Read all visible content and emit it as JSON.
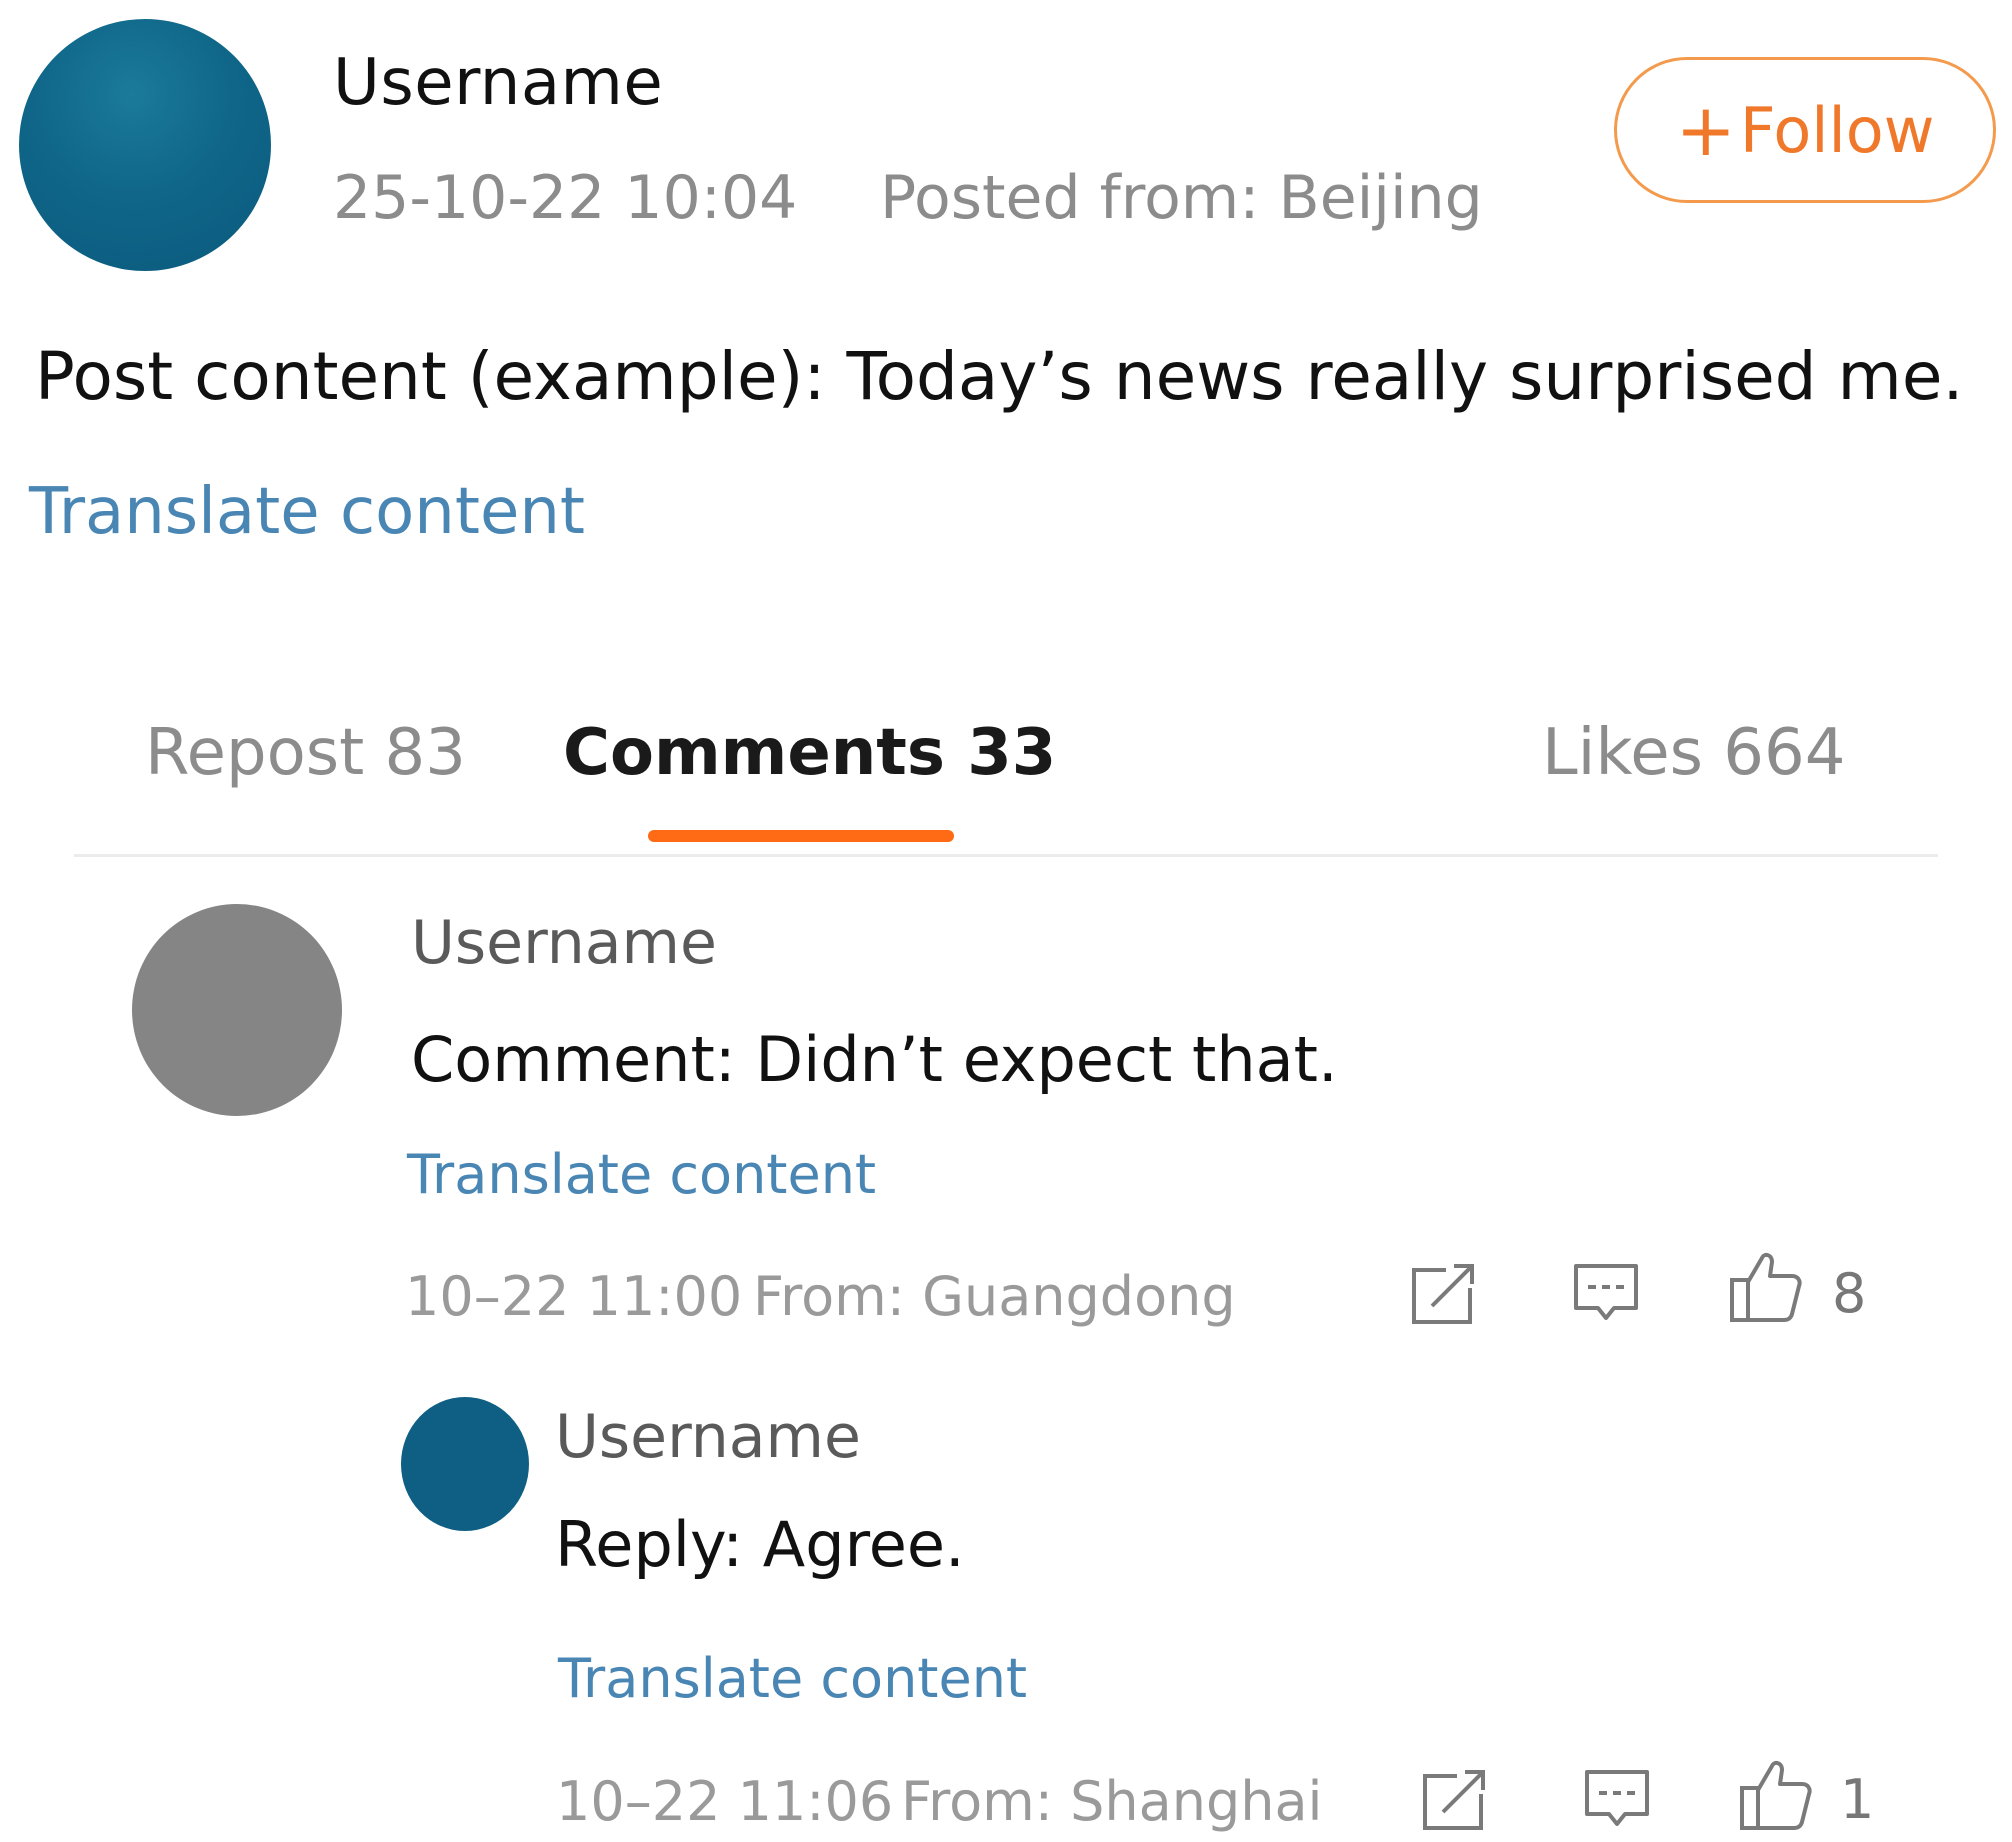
{
  "post": {
    "username": "Username",
    "timestamp": "25-10-22 10:04",
    "location": "Posted from: Beijing",
    "content": "Post content (example): Today’s news really surprised me.",
    "translate_label": "Translate content",
    "follow_label": "Follow",
    "follow_plus": "+",
    "avatar_color": "#0f6688"
  },
  "tabs": {
    "repost": "Repost 83",
    "comments": "Comments 33",
    "likes": "Likes 664",
    "active_underline_color": "#ff6a14"
  },
  "comment": {
    "username": "Username",
    "content": "Comment: Didn’t expect that.",
    "translate_label": "Translate content",
    "timestamp": "10–22 11:00",
    "location": "From: Guangdong",
    "like_count": "8",
    "avatar_color": "#858585",
    "icons": [
      "share-icon",
      "comment-icon",
      "thumbs-up-icon"
    ]
  },
  "reply": {
    "username": "Username",
    "content": "Reply: Agree.",
    "translate_label": "Translate content",
    "timestamp": "10–22 11:06",
    "location": "From: Shanghai",
    "like_count": "1",
    "avatar_color": "#0f5f84",
    "icons": [
      "share-icon",
      "comment-icon",
      "thumbs-up-icon"
    ]
  },
  "colors": {
    "accent": "#f0782a",
    "link": "#4a86b4",
    "muted": "#8c8c8c"
  }
}
